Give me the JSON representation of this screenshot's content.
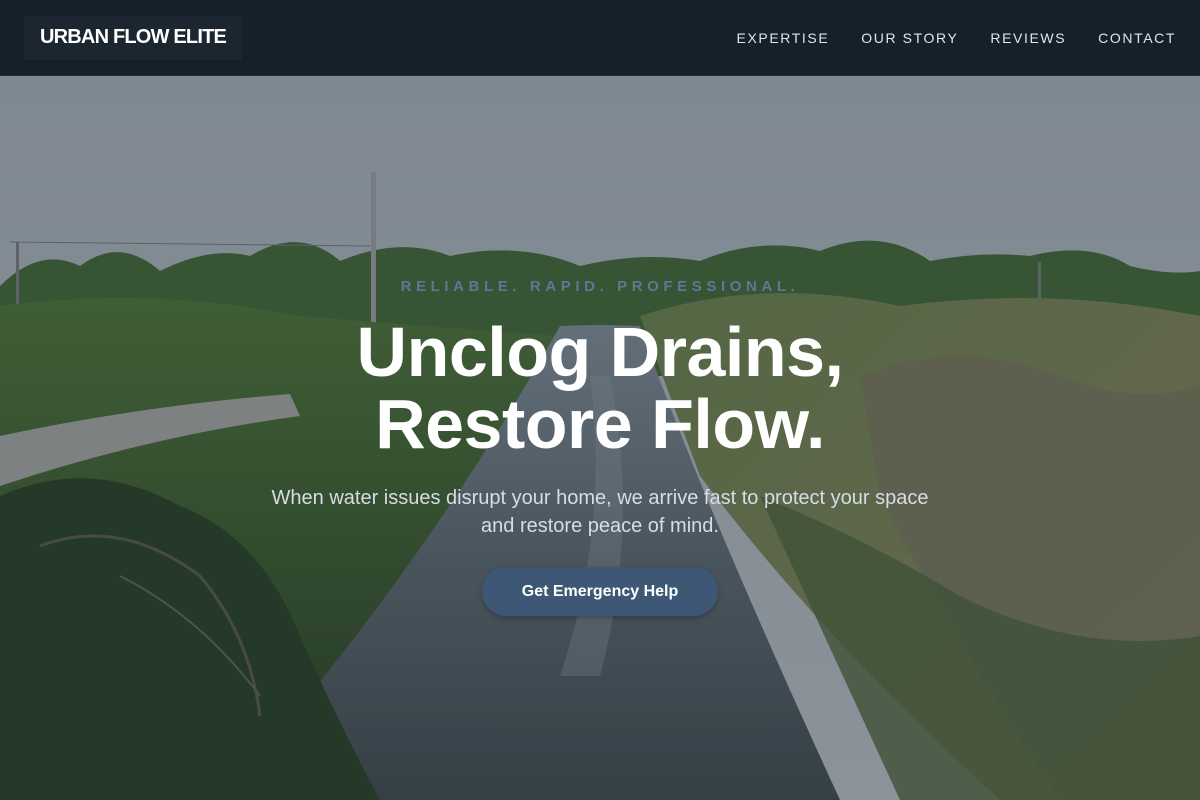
{
  "brand": {
    "name": "URBAN FLOW ELITE"
  },
  "nav": {
    "items": [
      {
        "label": "EXPERTISE"
      },
      {
        "label": "OUR STORY"
      },
      {
        "label": "REVIEWS"
      },
      {
        "label": "CONTACT"
      }
    ]
  },
  "hero": {
    "eyebrow": "RELIABLE. RAPID. PROFESSIONAL.",
    "headline_line1": "Unclog Drains,",
    "headline_line2": "Restore Flow.",
    "subtext": "When water issues disrupt your home, we arrive fast to protect your space and restore peace of mind.",
    "cta_label": "Get Emergency Help",
    "background_image": "canal-landscape-photo"
  },
  "colors": {
    "navbar_bg": "#16202b",
    "brand_bg": "#1c2631",
    "eyebrow": "#5d7896",
    "cta_bg": "#3d5775",
    "headline": "#ffffff"
  }
}
